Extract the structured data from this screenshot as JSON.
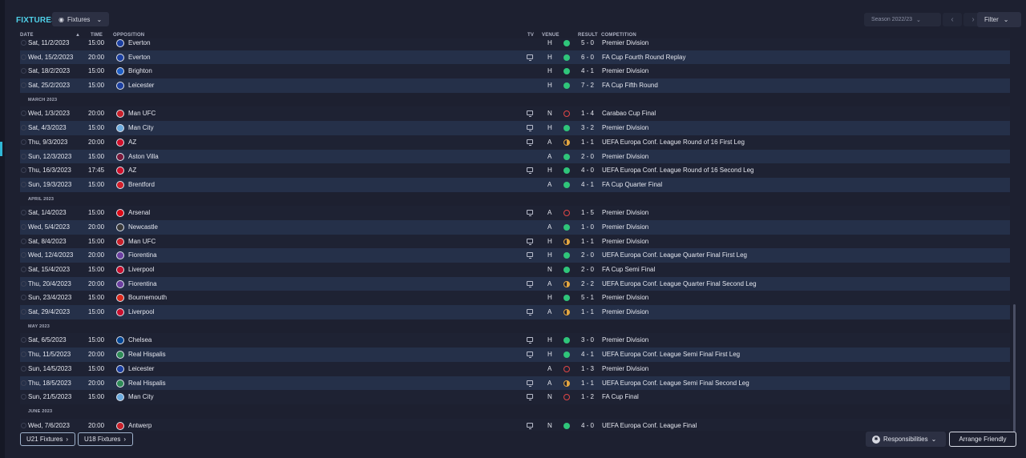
{
  "header": {
    "title": "FIXTURES",
    "view_label": "Fixtures",
    "season_label": "Season 2022/23",
    "filter_label": "Filter"
  },
  "columns": {
    "date": "DATE",
    "time": "TIME",
    "opposition": "OPPOSITION",
    "tv": "TV",
    "venue": "VENUE",
    "result": "RESULT",
    "competition": "COMPETITION"
  },
  "rows": [
    {
      "type": "fixture",
      "date": "Sat, 11/2/2023",
      "time": "15:00",
      "opponent": "Everton",
      "crest": "#1b3fa0",
      "tv": false,
      "venue": "H",
      "outcome": "win",
      "result": "5 - 0",
      "competition": "Premier Division"
    },
    {
      "type": "fixture",
      "date": "Wed, 15/2/2023",
      "time": "20:00",
      "opponent": "Everton",
      "crest": "#1b3fa0",
      "tv": true,
      "venue": "H",
      "outcome": "win",
      "result": "6 - 0",
      "competition": "FA Cup Fourth Round Replay"
    },
    {
      "type": "fixture",
      "date": "Sat, 18/2/2023",
      "time": "15:00",
      "opponent": "Brighton",
      "crest": "#1f5ec4",
      "tv": false,
      "venue": "H",
      "outcome": "win",
      "result": "4 - 1",
      "competition": "Premier Division"
    },
    {
      "type": "fixture",
      "date": "Sat, 25/2/2023",
      "time": "15:00",
      "opponent": "Leicester",
      "crest": "#1b3fa0",
      "tv": false,
      "venue": "H",
      "outcome": "win",
      "result": "7 - 2",
      "competition": "FA Cup Fifth Round"
    },
    {
      "type": "month",
      "label": "MARCH 2023"
    },
    {
      "type": "fixture",
      "date": "Wed, 1/3/2023",
      "time": "20:00",
      "opponent": "Man UFC",
      "crest": "#c8202a",
      "tv": true,
      "venue": "N",
      "outcome": "loss",
      "result": "1 - 4",
      "competition": "Carabao Cup Final"
    },
    {
      "type": "fixture",
      "date": "Sat, 4/3/2023",
      "time": "15:00",
      "opponent": "Man City",
      "crest": "#6cabdd",
      "tv": true,
      "venue": "H",
      "outcome": "win",
      "result": "3 - 2",
      "competition": "Premier Division"
    },
    {
      "type": "fixture",
      "date": "Thu, 9/3/2023",
      "time": "20:00",
      "opponent": "AZ",
      "crest": "#d0102a",
      "tv": true,
      "venue": "A",
      "outcome": "draw",
      "result": "1 - 1",
      "competition": "UEFA Europa Conf. League Round of 16 First Leg"
    },
    {
      "type": "fixture",
      "date": "Sun, 12/3/2023",
      "time": "15:00",
      "opponent": "Aston Villa",
      "crest": "#7a1a3c",
      "tv": false,
      "venue": "A",
      "outcome": "win",
      "result": "2 - 0",
      "competition": "Premier Division"
    },
    {
      "type": "fixture",
      "date": "Thu, 16/3/2023",
      "time": "17:45",
      "opponent": "AZ",
      "crest": "#d0102a",
      "tv": true,
      "venue": "H",
      "outcome": "win",
      "result": "4 - 0",
      "competition": "UEFA Europa Conf. League Round of 16 Second Leg"
    },
    {
      "type": "fixture",
      "date": "Sun, 19/3/2023",
      "time": "15:00",
      "opponent": "Brentford",
      "crest": "#d21f2a",
      "tv": false,
      "venue": "A",
      "outcome": "win",
      "result": "4 - 1",
      "competition": "FA Cup Quarter Final"
    },
    {
      "type": "month",
      "label": "APRIL 2023"
    },
    {
      "type": "fixture",
      "date": "Sat, 1/4/2023",
      "time": "15:00",
      "opponent": "Arsenal",
      "crest": "#db0a16",
      "tv": true,
      "venue": "A",
      "outcome": "loss",
      "result": "1 - 5",
      "competition": "Premier Division"
    },
    {
      "type": "fixture",
      "date": "Wed, 5/4/2023",
      "time": "20:00",
      "opponent": "Newcastle",
      "crest": "#3a3a3a",
      "tv": false,
      "venue": "A",
      "outcome": "win",
      "result": "1 - 0",
      "competition": "Premier Division"
    },
    {
      "type": "fixture",
      "date": "Sat, 8/4/2023",
      "time": "15:00",
      "opponent": "Man UFC",
      "crest": "#c8202a",
      "tv": true,
      "venue": "H",
      "outcome": "draw",
      "result": "1 - 1",
      "competition": "Premier Division"
    },
    {
      "type": "fixture",
      "date": "Wed, 12/4/2023",
      "time": "20:00",
      "opponent": "Fiorentina",
      "crest": "#6b3fa0",
      "tv": true,
      "venue": "H",
      "outcome": "win",
      "result": "2 - 0",
      "competition": "UEFA Europa Conf. League Quarter Final First Leg"
    },
    {
      "type": "fixture",
      "date": "Sat, 15/4/2023",
      "time": "15:00",
      "opponent": "Liverpool",
      "crest": "#c8102e",
      "tv": false,
      "venue": "N",
      "outcome": "win",
      "result": "2 - 0",
      "competition": "FA Cup Semi Final"
    },
    {
      "type": "fixture",
      "date": "Thu, 20/4/2023",
      "time": "20:00",
      "opponent": "Fiorentina",
      "crest": "#6b3fa0",
      "tv": true,
      "venue": "A",
      "outcome": "draw",
      "result": "2 - 2",
      "competition": "UEFA Europa Conf. League Quarter Final Second Leg"
    },
    {
      "type": "fixture",
      "date": "Sun, 23/4/2023",
      "time": "15:00",
      "opponent": "Bournemouth",
      "crest": "#da291c",
      "tv": false,
      "venue": "H",
      "outcome": "win",
      "result": "5 - 1",
      "competition": "Premier Division"
    },
    {
      "type": "fixture",
      "date": "Sat, 29/4/2023",
      "time": "15:00",
      "opponent": "Liverpool",
      "crest": "#c8102e",
      "tv": true,
      "venue": "A",
      "outcome": "draw",
      "result": "1 - 1",
      "competition": "Premier Division"
    },
    {
      "type": "month",
      "label": "MAY 2023"
    },
    {
      "type": "fixture",
      "date": "Sat, 6/5/2023",
      "time": "15:00",
      "opponent": "Chelsea",
      "crest": "#034694",
      "tv": true,
      "venue": "H",
      "outcome": "win",
      "result": "3 - 0",
      "competition": "Premier Division"
    },
    {
      "type": "fixture",
      "date": "Thu, 11/5/2023",
      "time": "20:00",
      "opponent": "Real Hispalis",
      "crest": "#2e8b57",
      "tv": true,
      "venue": "H",
      "outcome": "win",
      "result": "4 - 1",
      "competition": "UEFA Europa Conf. League Semi Final First Leg"
    },
    {
      "type": "fixture",
      "date": "Sun, 14/5/2023",
      "time": "15:00",
      "opponent": "Leicester",
      "crest": "#1b3fa0",
      "tv": false,
      "venue": "A",
      "outcome": "loss",
      "result": "1 - 3",
      "competition": "Premier Division"
    },
    {
      "type": "fixture",
      "date": "Thu, 18/5/2023",
      "time": "20:00",
      "opponent": "Real Hispalis",
      "crest": "#2e8b57",
      "tv": true,
      "venue": "A",
      "outcome": "draw",
      "result": "1 - 1",
      "competition": "UEFA Europa Conf. League Semi Final Second Leg"
    },
    {
      "type": "fixture",
      "date": "Sun, 21/5/2023",
      "time": "15:00",
      "opponent": "Man City",
      "crest": "#6cabdd",
      "tv": true,
      "venue": "N",
      "outcome": "loss",
      "result": "1 - 2",
      "competition": "FA Cup Final"
    },
    {
      "type": "month",
      "label": "JUNE 2023"
    },
    {
      "type": "fixture",
      "date": "Wed, 7/6/2023",
      "time": "20:00",
      "opponent": "Antwerp",
      "crest": "#c8202a",
      "tv": true,
      "venue": "N",
      "outcome": "win",
      "result": "4 - 0",
      "competition": "UEFA Europa Conf. League Final"
    }
  ],
  "footer": {
    "u21_label": "U21 Fixtures",
    "u18_label": "U18 Fixtures",
    "responsibilities_label": "Responsibilities",
    "arrange_label": "Arrange Friendly"
  },
  "icons": {
    "sort": "sort-ascending-icon",
    "eye": "eye-icon",
    "chevron": "chevron-down-icon",
    "tv": "tv-icon",
    "gear": "gear-icon"
  },
  "colors": {
    "accent": "#4fd0e8",
    "win": "#2fc57a",
    "loss": "#e04646",
    "draw": "#e3a640"
  }
}
